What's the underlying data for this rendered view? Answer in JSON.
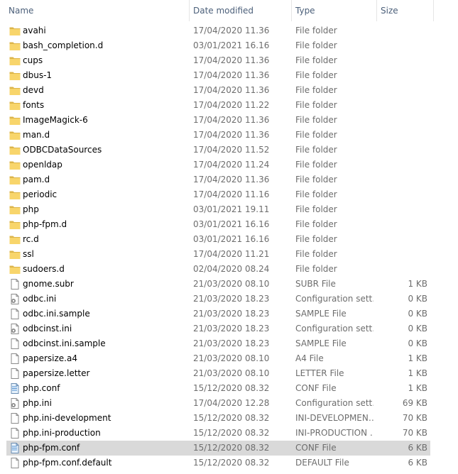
{
  "columns": {
    "name": "Name",
    "date_modified": "Date modified",
    "type": "Type",
    "size": "Size"
  },
  "sort_indicator": "^",
  "files": [
    {
      "name": "avahi",
      "date": "17/04/2020 11.36",
      "type": "File folder",
      "size": "",
      "icon": "folder-icon"
    },
    {
      "name": "bash_completion.d",
      "date": "03/01/2021 16.16",
      "type": "File folder",
      "size": "",
      "icon": "folder-icon"
    },
    {
      "name": "cups",
      "date": "17/04/2020 11.36",
      "type": "File folder",
      "size": "",
      "icon": "folder-icon"
    },
    {
      "name": "dbus-1",
      "date": "17/04/2020 11.36",
      "type": "File folder",
      "size": "",
      "icon": "folder-icon"
    },
    {
      "name": "devd",
      "date": "17/04/2020 11.36",
      "type": "File folder",
      "size": "",
      "icon": "folder-icon"
    },
    {
      "name": "fonts",
      "date": "17/04/2020 11.22",
      "type": "File folder",
      "size": "",
      "icon": "folder-icon"
    },
    {
      "name": "ImageMagick-6",
      "date": "17/04/2020 11.36",
      "type": "File folder",
      "size": "",
      "icon": "folder-icon"
    },
    {
      "name": "man.d",
      "date": "17/04/2020 11.36",
      "type": "File folder",
      "size": "",
      "icon": "folder-icon"
    },
    {
      "name": "ODBCDataSources",
      "date": "17/04/2020 11.52",
      "type": "File folder",
      "size": "",
      "icon": "folder-icon"
    },
    {
      "name": "openldap",
      "date": "17/04/2020 11.24",
      "type": "File folder",
      "size": "",
      "icon": "folder-icon"
    },
    {
      "name": "pam.d",
      "date": "17/04/2020 11.36",
      "type": "File folder",
      "size": "",
      "icon": "folder-icon"
    },
    {
      "name": "periodic",
      "date": "17/04/2020 11.16",
      "type": "File folder",
      "size": "",
      "icon": "folder-icon"
    },
    {
      "name": "php",
      "date": "03/01/2021 19.11",
      "type": "File folder",
      "size": "",
      "icon": "folder-icon"
    },
    {
      "name": "php-fpm.d",
      "date": "03/01/2021 16.16",
      "type": "File folder",
      "size": "",
      "icon": "folder-icon"
    },
    {
      "name": "rc.d",
      "date": "03/01/2021 16.16",
      "type": "File folder",
      "size": "",
      "icon": "folder-icon"
    },
    {
      "name": "ssl",
      "date": "17/04/2020 11.21",
      "type": "File folder",
      "size": "",
      "icon": "folder-icon"
    },
    {
      "name": "sudoers.d",
      "date": "02/04/2020 08.24",
      "type": "File folder",
      "size": "",
      "icon": "folder-icon"
    },
    {
      "name": "gnome.subr",
      "date": "21/03/2020 08.10",
      "type": "SUBR File",
      "size": "1 KB",
      "icon": "file-icon"
    },
    {
      "name": "odbc.ini",
      "date": "21/03/2020 18.23",
      "type": "Configuration sett…",
      "size": "0 KB",
      "icon": "config-file-icon"
    },
    {
      "name": "odbc.ini.sample",
      "date": "21/03/2020 18.23",
      "type": "SAMPLE File",
      "size": "0 KB",
      "icon": "file-icon"
    },
    {
      "name": "odbcinst.ini",
      "date": "21/03/2020 18.23",
      "type": "Configuration sett…",
      "size": "0 KB",
      "icon": "config-file-icon"
    },
    {
      "name": "odbcinst.ini.sample",
      "date": "21/03/2020 18.23",
      "type": "SAMPLE File",
      "size": "0 KB",
      "icon": "file-icon"
    },
    {
      "name": "papersize.a4",
      "date": "21/03/2020 08.10",
      "type": "A4 File",
      "size": "1 KB",
      "icon": "file-icon"
    },
    {
      "name": "papersize.letter",
      "date": "21/03/2020 08.10",
      "type": "LETTER File",
      "size": "1 KB",
      "icon": "file-icon"
    },
    {
      "name": "php.conf",
      "date": "15/12/2020 08.32",
      "type": "CONF File",
      "size": "1 KB",
      "icon": "conf-file-icon"
    },
    {
      "name": "php.ini",
      "date": "17/04/2020 12.28",
      "type": "Configuration sett…",
      "size": "69 KB",
      "icon": "config-file-icon"
    },
    {
      "name": "php.ini-development",
      "date": "15/12/2020 08.32",
      "type": "INI-DEVELOPMEN…",
      "size": "70 KB",
      "icon": "file-icon"
    },
    {
      "name": "php.ini-production",
      "date": "15/12/2020 08.32",
      "type": "INI-PRODUCTION …",
      "size": "70 KB",
      "icon": "file-icon"
    },
    {
      "name": "php-fpm.conf",
      "date": "15/12/2020 08.32",
      "type": "CONF File",
      "size": "6 KB",
      "icon": "conf-file-icon",
      "selected": true
    },
    {
      "name": "php-fpm.conf.default",
      "date": "15/12/2020 08.32",
      "type": "DEFAULT File",
      "size": "6 KB",
      "icon": "file-icon"
    }
  ]
}
